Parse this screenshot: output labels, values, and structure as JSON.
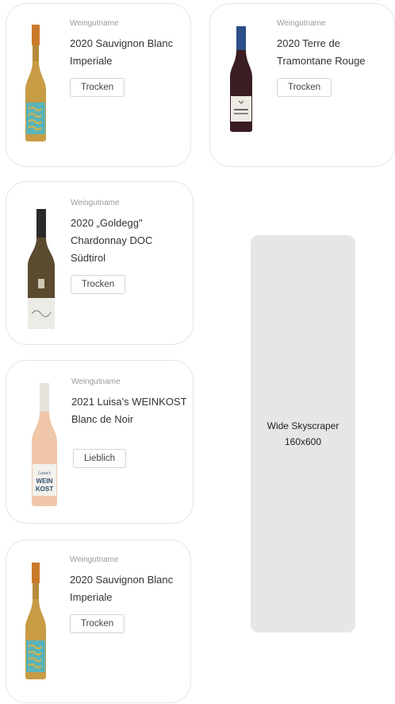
{
  "products": [
    {
      "winery": "Weingutname",
      "name_line1": "2020 Sauvignon Blanc",
      "name_line2": "Imperiale",
      "name_line3": "",
      "tag": "Trocken"
    },
    {
      "winery": "Weingutname",
      "name_line1": "2020 Terre de",
      "name_line2": "Tramontane Rouge",
      "name_line3": "",
      "tag": "Trocken"
    },
    {
      "winery": "Weingutname",
      "name_line1": "2020 „Goldegg\"",
      "name_line2": "Chardonnay DOC",
      "name_line3": "Südtirol",
      "tag": "Trocken"
    },
    {
      "winery": "Weingutname",
      "name_line1": "2021 Luisa's WEINKOST",
      "name_line2": "Blanc de Noir",
      "name_line3": "",
      "tag": "Lieblich"
    },
    {
      "winery": "Weingutname",
      "name_line1": "2020 Sauvignon Blanc",
      "name_line2": "Imperiale",
      "name_line3": "",
      "tag": "Trocken"
    }
  ],
  "ad": {
    "line1": "Wide Skyscraper",
    "line2": "160x600",
    "color": "#e6e6e6"
  },
  "label_texts": {
    "rose_label": "Luisa's WEIN KOST"
  }
}
